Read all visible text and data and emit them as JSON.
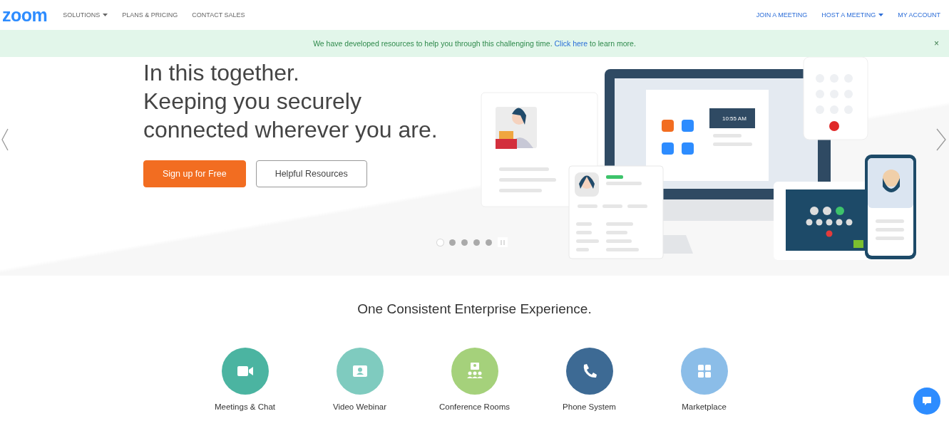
{
  "header": {
    "logo": "zoom",
    "nav_left": [
      {
        "label": "SOLUTIONS",
        "dropdown": true
      },
      {
        "label": "PLANS & PRICING",
        "dropdown": false
      },
      {
        "label": "CONTACT SALES",
        "dropdown": false
      }
    ],
    "nav_right": [
      {
        "label": "JOIN A MEETING",
        "dropdown": false
      },
      {
        "label": "HOST A MEETING",
        "dropdown": true
      },
      {
        "label": "MY ACCOUNT",
        "dropdown": false
      }
    ]
  },
  "notice": {
    "text": "We have developed resources to help you through this challenging time.",
    "link": "Click here",
    "after": "to learn more.",
    "close": "×"
  },
  "hero": {
    "headline": [
      "In this together.",
      "Keeping you securely",
      "connected wherever you are."
    ],
    "buttons": [
      {
        "label": "Sign up for Free",
        "kind": "primary"
      },
      {
        "label": "Helpful Resources",
        "kind": "outline"
      }
    ],
    "clock": "10:55 AM",
    "dots": [
      {
        "selected": true
      },
      {
        "selected": false
      },
      {
        "selected": false
      },
      {
        "selected": false
      },
      {
        "selected": false
      }
    ]
  },
  "section": {
    "title": "One Consistent Enterprise Experience.",
    "products": [
      {
        "label": "Meetings & Chat",
        "kind": "video",
        "color": "#4bb4a1"
      },
      {
        "label": "Video Webinar",
        "kind": "webinar",
        "color": "#7fcbbf"
      },
      {
        "label": "Conference Rooms",
        "kind": "rooms",
        "color": "#a5d17b"
      },
      {
        "label": "Phone System",
        "kind": "phone",
        "color": "#3d6a94"
      },
      {
        "label": "Marketplace",
        "kind": "grid",
        "color": "#8bbde8"
      }
    ]
  }
}
